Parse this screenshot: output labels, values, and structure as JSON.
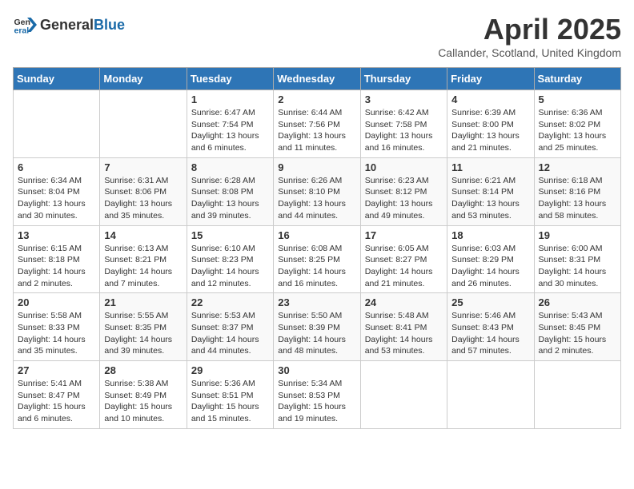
{
  "header": {
    "logo_general": "General",
    "logo_blue": "Blue",
    "month_title": "April 2025",
    "location": "Callander, Scotland, United Kingdom"
  },
  "weekdays": [
    "Sunday",
    "Monday",
    "Tuesday",
    "Wednesday",
    "Thursday",
    "Friday",
    "Saturday"
  ],
  "weeks": [
    {
      "days": [
        {
          "num": "",
          "info": ""
        },
        {
          "num": "",
          "info": ""
        },
        {
          "num": "1",
          "info": "Sunrise: 6:47 AM\nSunset: 7:54 PM\nDaylight: 13 hours and 6 minutes."
        },
        {
          "num": "2",
          "info": "Sunrise: 6:44 AM\nSunset: 7:56 PM\nDaylight: 13 hours and 11 minutes."
        },
        {
          "num": "3",
          "info": "Sunrise: 6:42 AM\nSunset: 7:58 PM\nDaylight: 13 hours and 16 minutes."
        },
        {
          "num": "4",
          "info": "Sunrise: 6:39 AM\nSunset: 8:00 PM\nDaylight: 13 hours and 21 minutes."
        },
        {
          "num": "5",
          "info": "Sunrise: 6:36 AM\nSunset: 8:02 PM\nDaylight: 13 hours and 25 minutes."
        }
      ]
    },
    {
      "days": [
        {
          "num": "6",
          "info": "Sunrise: 6:34 AM\nSunset: 8:04 PM\nDaylight: 13 hours and 30 minutes."
        },
        {
          "num": "7",
          "info": "Sunrise: 6:31 AM\nSunset: 8:06 PM\nDaylight: 13 hours and 35 minutes."
        },
        {
          "num": "8",
          "info": "Sunrise: 6:28 AM\nSunset: 8:08 PM\nDaylight: 13 hours and 39 minutes."
        },
        {
          "num": "9",
          "info": "Sunrise: 6:26 AM\nSunset: 8:10 PM\nDaylight: 13 hours and 44 minutes."
        },
        {
          "num": "10",
          "info": "Sunrise: 6:23 AM\nSunset: 8:12 PM\nDaylight: 13 hours and 49 minutes."
        },
        {
          "num": "11",
          "info": "Sunrise: 6:21 AM\nSunset: 8:14 PM\nDaylight: 13 hours and 53 minutes."
        },
        {
          "num": "12",
          "info": "Sunrise: 6:18 AM\nSunset: 8:16 PM\nDaylight: 13 hours and 58 minutes."
        }
      ]
    },
    {
      "days": [
        {
          "num": "13",
          "info": "Sunrise: 6:15 AM\nSunset: 8:18 PM\nDaylight: 14 hours and 2 minutes."
        },
        {
          "num": "14",
          "info": "Sunrise: 6:13 AM\nSunset: 8:21 PM\nDaylight: 14 hours and 7 minutes."
        },
        {
          "num": "15",
          "info": "Sunrise: 6:10 AM\nSunset: 8:23 PM\nDaylight: 14 hours and 12 minutes."
        },
        {
          "num": "16",
          "info": "Sunrise: 6:08 AM\nSunset: 8:25 PM\nDaylight: 14 hours and 16 minutes."
        },
        {
          "num": "17",
          "info": "Sunrise: 6:05 AM\nSunset: 8:27 PM\nDaylight: 14 hours and 21 minutes."
        },
        {
          "num": "18",
          "info": "Sunrise: 6:03 AM\nSunset: 8:29 PM\nDaylight: 14 hours and 26 minutes."
        },
        {
          "num": "19",
          "info": "Sunrise: 6:00 AM\nSunset: 8:31 PM\nDaylight: 14 hours and 30 minutes."
        }
      ]
    },
    {
      "days": [
        {
          "num": "20",
          "info": "Sunrise: 5:58 AM\nSunset: 8:33 PM\nDaylight: 14 hours and 35 minutes."
        },
        {
          "num": "21",
          "info": "Sunrise: 5:55 AM\nSunset: 8:35 PM\nDaylight: 14 hours and 39 minutes."
        },
        {
          "num": "22",
          "info": "Sunrise: 5:53 AM\nSunset: 8:37 PM\nDaylight: 14 hours and 44 minutes."
        },
        {
          "num": "23",
          "info": "Sunrise: 5:50 AM\nSunset: 8:39 PM\nDaylight: 14 hours and 48 minutes."
        },
        {
          "num": "24",
          "info": "Sunrise: 5:48 AM\nSunset: 8:41 PM\nDaylight: 14 hours and 53 minutes."
        },
        {
          "num": "25",
          "info": "Sunrise: 5:46 AM\nSunset: 8:43 PM\nDaylight: 14 hours and 57 minutes."
        },
        {
          "num": "26",
          "info": "Sunrise: 5:43 AM\nSunset: 8:45 PM\nDaylight: 15 hours and 2 minutes."
        }
      ]
    },
    {
      "days": [
        {
          "num": "27",
          "info": "Sunrise: 5:41 AM\nSunset: 8:47 PM\nDaylight: 15 hours and 6 minutes."
        },
        {
          "num": "28",
          "info": "Sunrise: 5:38 AM\nSunset: 8:49 PM\nDaylight: 15 hours and 10 minutes."
        },
        {
          "num": "29",
          "info": "Sunrise: 5:36 AM\nSunset: 8:51 PM\nDaylight: 15 hours and 15 minutes."
        },
        {
          "num": "30",
          "info": "Sunrise: 5:34 AM\nSunset: 8:53 PM\nDaylight: 15 hours and 19 minutes."
        },
        {
          "num": "",
          "info": ""
        },
        {
          "num": "",
          "info": ""
        },
        {
          "num": "",
          "info": ""
        }
      ]
    }
  ]
}
